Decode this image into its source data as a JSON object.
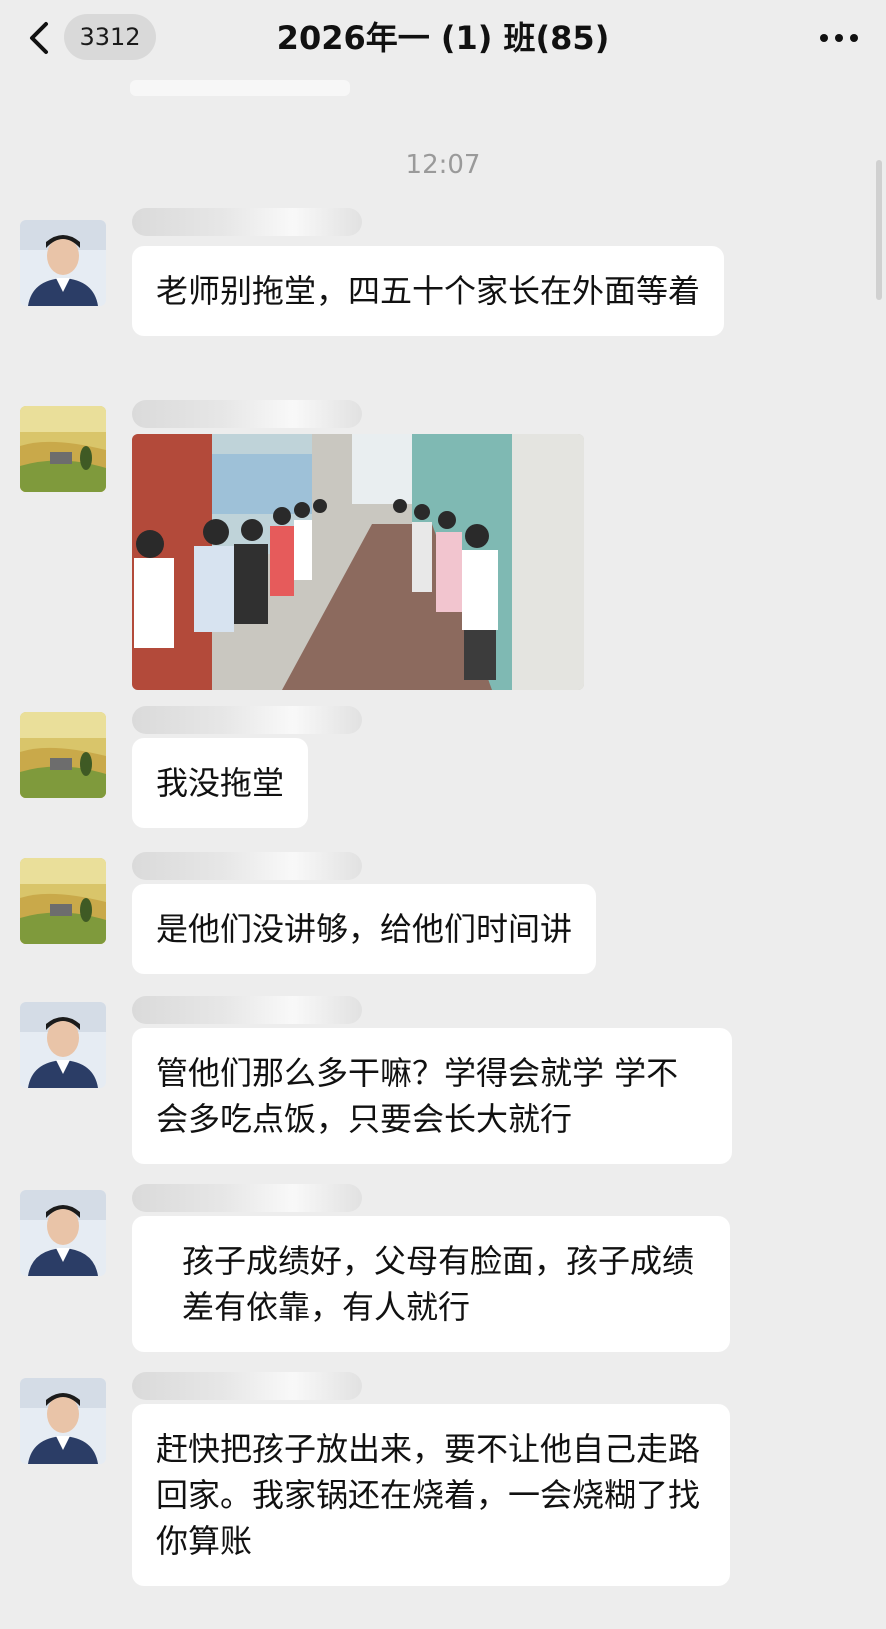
{
  "header": {
    "badge_count": "3312",
    "title": "2026年一 (1) 班(85)"
  },
  "timestamp": "12:07",
  "messages": [
    {
      "type": "text",
      "avatar": "man-avatar",
      "text": "老师别拖堂，四五十个家长在外面等着"
    },
    {
      "type": "image",
      "avatar": "landscape-avatar",
      "image": "children-lined-up-in-corridor-photo"
    },
    {
      "type": "text",
      "avatar": "landscape-avatar",
      "text": "我没拖堂"
    },
    {
      "type": "text",
      "avatar": "landscape-avatar",
      "text": "是他们没讲够，给他们时间讲"
    },
    {
      "type": "text",
      "avatar": "man-avatar",
      "text": "管他们那么多干嘛？学得会就学 学不会多吃点饭，只要会长大就行"
    },
    {
      "type": "text",
      "avatar": "man-avatar",
      "text": "孩子成绩好，父母有脸面，孩子成绩差有依靠，有人就行"
    },
    {
      "type": "text",
      "avatar": "man-avatar",
      "text": "赶快把孩子放出来，要不让他自己走路回家。我家锅还在烧着，一会烧糊了找你算账"
    }
  ],
  "colors": {
    "background": "#ededed",
    "bubble": "#ffffff",
    "timestamp": "#9a9a9a"
  }
}
